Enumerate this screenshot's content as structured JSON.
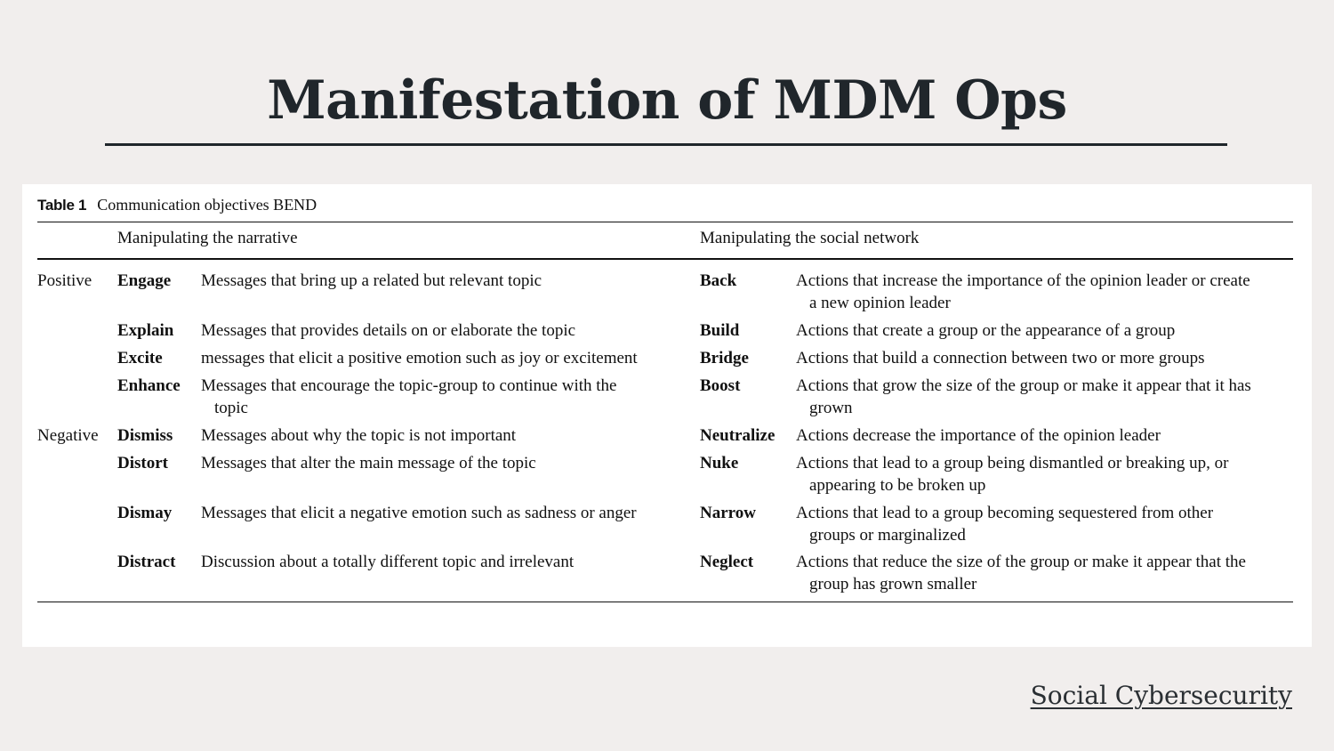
{
  "slide": {
    "title": "Manifestation of MDM Ops",
    "footer_link": "Social Cybersecurity"
  },
  "table": {
    "label": "Table 1",
    "caption": "Communication objectives BEND",
    "headers": {
      "narrative": "Manipulating the narrative",
      "network": "Manipulating the social network"
    },
    "groups": {
      "positive": "Positive",
      "negative": "Negative"
    },
    "rows": [
      {
        "n_term": "Engage",
        "n_desc": [
          "Messages that bring up a related but relevant topic"
        ],
        "s_term": "Back",
        "s_desc": [
          "Actions that increase the importance of the opinion leader or create",
          "a new opinion leader"
        ]
      },
      {
        "n_term": "Explain",
        "n_desc": [
          "Messages that provides details on or elaborate the topic"
        ],
        "s_term": "Build",
        "s_desc": [
          "Actions that create a group or the appearance of a group"
        ]
      },
      {
        "n_term": "Excite",
        "n_desc": [
          "messages that elicit a positive emotion such as joy or excitement"
        ],
        "s_term": "Bridge",
        "s_desc": [
          "Actions that build a connection between two or more groups"
        ]
      },
      {
        "n_term": "Enhance",
        "n_desc": [
          "Messages that encourage the topic-group to continue with the",
          "topic"
        ],
        "s_term": "Boost",
        "s_desc": [
          "Actions that grow the size of the group or make it appear that it has",
          "grown"
        ]
      },
      {
        "n_term": "Dismiss",
        "n_desc": [
          "Messages about why the topic is not important"
        ],
        "s_term": "Neutralize",
        "s_desc": [
          "Actions decrease the importance of the opinion leader"
        ]
      },
      {
        "n_term": "Distort",
        "n_desc": [
          "Messages that alter the main message of the topic"
        ],
        "s_term": "Nuke",
        "s_desc": [
          "Actions that lead to a group being dismantled or breaking up, or",
          "appearing to be broken up"
        ]
      },
      {
        "n_term": "Dismay",
        "n_desc": [
          "Messages that elicit a negative emotion such as sadness or anger"
        ],
        "s_term": "Narrow",
        "s_desc": [
          "Actions that lead to a group becoming sequestered from other",
          "groups or marginalized"
        ]
      },
      {
        "n_term": "Distract",
        "n_desc": [
          "Discussion about a totally different topic and irrelevant"
        ],
        "s_term": "Neglect",
        "s_desc": [
          "Actions that reduce the size of the group or make it appear that the",
          "group has grown smaller"
        ]
      }
    ]
  }
}
